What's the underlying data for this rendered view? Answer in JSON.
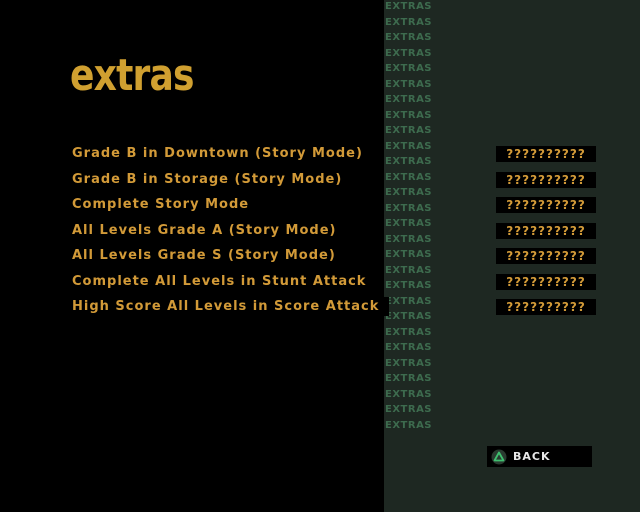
{
  "title": "extras",
  "watermark": {
    "text": "EXTRAS",
    "repeat": 28
  },
  "extras": [
    {
      "requirement": "Grade B in Downtown (Story Mode)",
      "reward": "??????????"
    },
    {
      "requirement": "Grade B in Storage (Story Mode)",
      "reward": "??????????"
    },
    {
      "requirement": "Complete Story Mode",
      "reward": "??????????"
    },
    {
      "requirement": "All Levels Grade A (Story Mode)",
      "reward": "??????????"
    },
    {
      "requirement": "All Levels Grade S (Story Mode)",
      "reward": "??????????"
    },
    {
      "requirement": "Complete All Levels in Stunt Attack",
      "reward": "??????????"
    },
    {
      "requirement": "High Score All Levels in Score Attack",
      "reward": "??????????"
    }
  ],
  "back_button": {
    "label": "BACK",
    "icon": "triangle-button-icon"
  },
  "colors": {
    "accent": "#d29a38",
    "panel": "#1e2822",
    "watermark": "#3d6b4e",
    "triangle": "#3fbf6f"
  }
}
